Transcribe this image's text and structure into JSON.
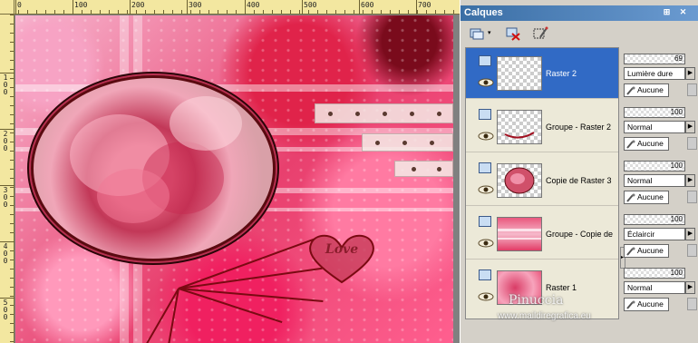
{
  "ruler": {
    "h_labels": [
      "0",
      "100",
      "200",
      "300",
      "400",
      "500",
      "600",
      "700"
    ],
    "v_labels": [
      "1\n0\n0",
      "2\n0\n0",
      "3\n0\n0",
      "4\n0\n0",
      "5\n0\n0"
    ]
  },
  "canvas": {
    "heart_text": "Love"
  },
  "palette": {
    "title": "Calques",
    "title_controls": [
      "pin-icon",
      "close-icon"
    ],
    "toolbar": [
      "new-layer-icon",
      "delete-layer-icon",
      "edit-selection-icon"
    ],
    "layers": [
      {
        "name": "Raster 2",
        "selected": true
      },
      {
        "name": "Groupe - Raster 2",
        "selected": false
      },
      {
        "name": "Copie de Raster 3",
        "selected": false
      },
      {
        "name": "Groupe - Copie de",
        "selected": false
      },
      {
        "name": "Raster 1",
        "selected": false
      }
    ],
    "properties": [
      {
        "opacity": "69",
        "blend": "Lumière dure",
        "mode": "Aucune"
      },
      {
        "opacity": "100",
        "blend": "Normal",
        "mode": "Aucune"
      },
      {
        "opacity": "100",
        "blend": "Normal",
        "mode": "Aucune"
      },
      {
        "opacity": "100",
        "blend": "Éclaircir",
        "mode": "Aucune"
      },
      {
        "opacity": "100",
        "blend": "Normal",
        "mode": "Aucune"
      }
    ],
    "colors": {
      "title_bar": "#3a6ea5",
      "selection": "#316ac5"
    }
  },
  "watermark": {
    "name": "Pinuccia",
    "url": "www.maildiregrafica.eu"
  }
}
